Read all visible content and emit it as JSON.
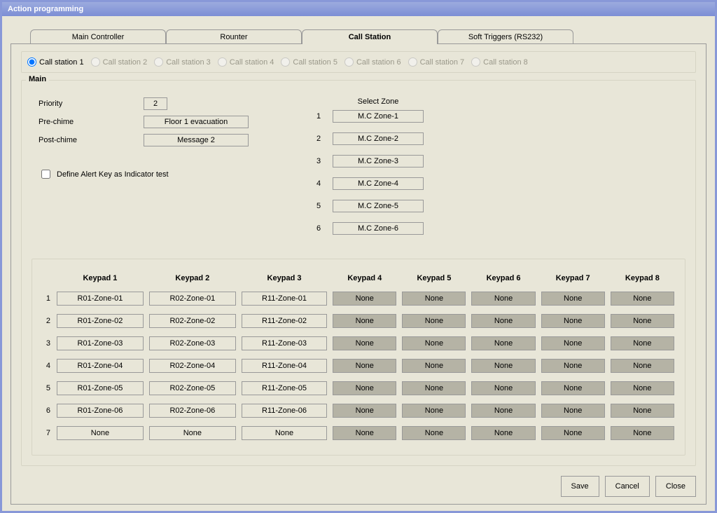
{
  "window": {
    "title": "Action programming"
  },
  "tabs": {
    "items": [
      {
        "label": "Main Controller"
      },
      {
        "label": "Rounter"
      },
      {
        "label": "Call Station"
      },
      {
        "label": "Soft Triggers (RS232)"
      }
    ],
    "active_index": 2
  },
  "stations": {
    "items": [
      {
        "label": "Call station 1",
        "enabled": true,
        "checked": true
      },
      {
        "label": "Call station 2",
        "enabled": false,
        "checked": false
      },
      {
        "label": "Call station 3",
        "enabled": false,
        "checked": false
      },
      {
        "label": "Call station 4",
        "enabled": false,
        "checked": false
      },
      {
        "label": "Call station 5",
        "enabled": false,
        "checked": false
      },
      {
        "label": "Call station 6",
        "enabled": false,
        "checked": false
      },
      {
        "label": "Call station 7",
        "enabled": false,
        "checked": false
      },
      {
        "label": "Call station 8",
        "enabled": false,
        "checked": false
      }
    ]
  },
  "main": {
    "legend": "Main",
    "priority_label": "Priority",
    "priority_value": "2",
    "prechime_label": "Pre-chime",
    "prechime_value": "Floor 1 evacuation",
    "postchime_label": "Post-chime",
    "postchime_value": "Message 2",
    "alert_checkbox_label": "Define Alert Key as Indicator test",
    "alert_checked": false,
    "select_zone_label": "Select Zone",
    "zones": [
      {
        "num": "1",
        "value": "M.C Zone-1"
      },
      {
        "num": "2",
        "value": "M.C Zone-2"
      },
      {
        "num": "3",
        "value": "M.C Zone-3"
      },
      {
        "num": "4",
        "value": "M.C Zone-4"
      },
      {
        "num": "5",
        "value": "M.C Zone-5"
      },
      {
        "num": "6",
        "value": "M.C Zone-6"
      }
    ]
  },
  "keypad": {
    "headers": [
      "Keypad 1",
      "Keypad 2",
      "Keypad 3",
      "Keypad 4",
      "Keypad 5",
      "Keypad 6",
      "Keypad 7",
      "Keypad 8"
    ],
    "rows": [
      {
        "num": "1",
        "cells": [
          "R01-Zone-01",
          "R02-Zone-01",
          "R11-Zone-01",
          "None",
          "None",
          "None",
          "None",
          "None"
        ]
      },
      {
        "num": "2",
        "cells": [
          "R01-Zone-02",
          "R02-Zone-02",
          "R11-Zone-02",
          "None",
          "None",
          "None",
          "None",
          "None"
        ]
      },
      {
        "num": "3",
        "cells": [
          "R01-Zone-03",
          "R02-Zone-03",
          "R11-Zone-03",
          "None",
          "None",
          "None",
          "None",
          "None"
        ]
      },
      {
        "num": "4",
        "cells": [
          "R01-Zone-04",
          "R02-Zone-04",
          "R11-Zone-04",
          "None",
          "None",
          "None",
          "None",
          "None"
        ]
      },
      {
        "num": "5",
        "cells": [
          "R01-Zone-05",
          "R02-Zone-05",
          "R11-Zone-05",
          "None",
          "None",
          "None",
          "None",
          "None"
        ]
      },
      {
        "num": "6",
        "cells": [
          "R01-Zone-06",
          "R02-Zone-06",
          "R11-Zone-06",
          "None",
          "None",
          "None",
          "None",
          "None"
        ]
      },
      {
        "num": "7",
        "cells": [
          "None",
          "None",
          "None",
          "None",
          "None",
          "None",
          "None",
          "None"
        ]
      }
    ],
    "grey_from_col": 3
  },
  "buttons": {
    "save": "Save",
    "cancel": "Cancel",
    "close": "Close"
  }
}
